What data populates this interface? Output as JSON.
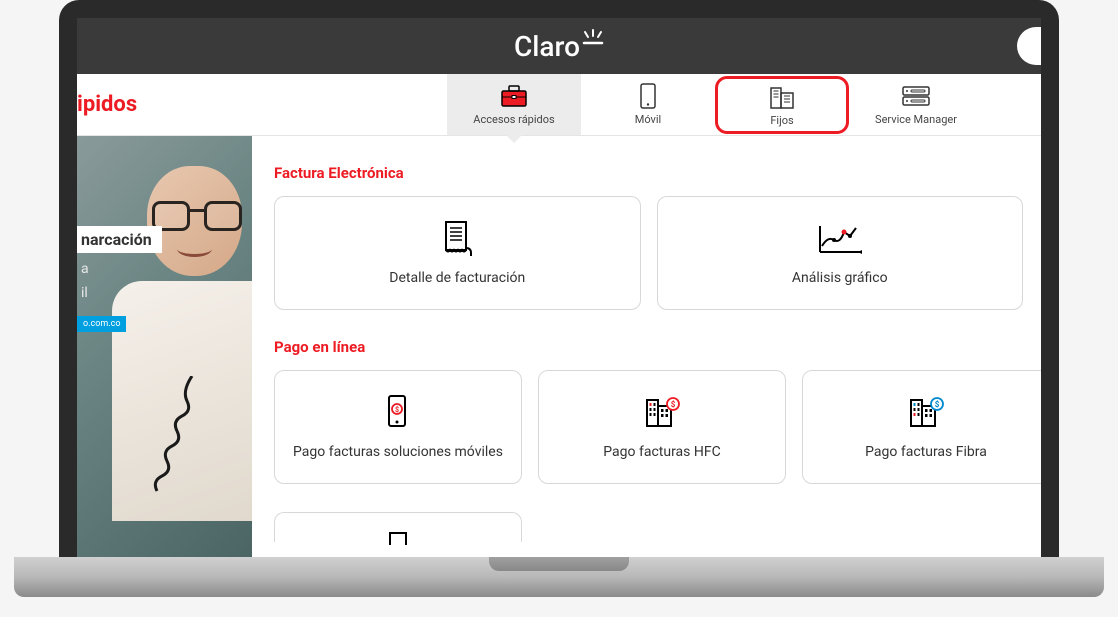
{
  "brand": {
    "name": "Claro"
  },
  "page_title_partial": "ipidos",
  "nav": {
    "tabs": [
      {
        "id": "accesos",
        "label": "Accesos rápidos",
        "active": true
      },
      {
        "id": "movil",
        "label": "Móvil"
      },
      {
        "id": "fijos",
        "label": "Fijos",
        "highlighted": true
      },
      {
        "id": "service",
        "label": "Service Manager"
      }
    ]
  },
  "banner": {
    "headline_partial": "narcación",
    "sub1": "a",
    "sub2": "il",
    "footer_partial": "o.com.co"
  },
  "sections": {
    "factura": {
      "title": "Factura Electrónica",
      "cards": [
        {
          "id": "detalle",
          "label": "Detalle de facturación"
        },
        {
          "id": "analisis",
          "label": "Análisis gráfico"
        }
      ]
    },
    "pago": {
      "title": "Pago en línea",
      "cards": [
        {
          "id": "moviles",
          "label": "Pago facturas soluciones móviles"
        },
        {
          "id": "hfc",
          "label": "Pago facturas HFC"
        },
        {
          "id": "fibra",
          "label": "Pago facturas Fibra"
        }
      ]
    }
  }
}
